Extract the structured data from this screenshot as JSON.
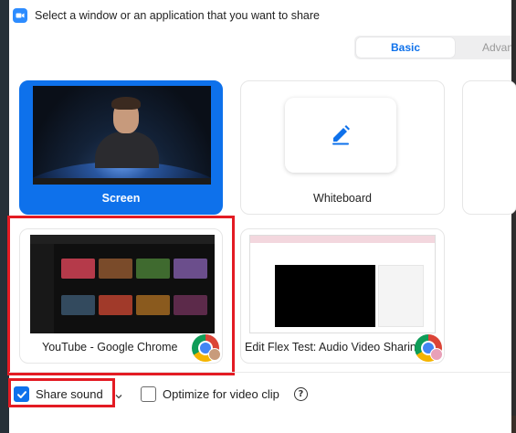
{
  "title": "Select a window or an application that you want to share",
  "tabs": [
    {
      "label": "Basic",
      "active": true
    },
    {
      "label": "Advan",
      "active": false
    }
  ],
  "tiles": [
    {
      "label": "Screen",
      "selected": true
    },
    {
      "label": "Whiteboard",
      "selected": false
    },
    {
      "label": "YouTube - Google Chrome",
      "selected": false,
      "icon": "chrome-icon"
    },
    {
      "label": "Edit Flex Test: Audio Video Sharin...",
      "selected": false,
      "icon": "chrome-icon"
    }
  ],
  "footer": {
    "share_sound": {
      "label": "Share sound",
      "checked": true
    },
    "optimize": {
      "label": "Optimize for video clip",
      "checked": false
    },
    "help_symbol": "?"
  },
  "colors": {
    "accent": "#0e71eb",
    "highlight": "#e31b23"
  }
}
